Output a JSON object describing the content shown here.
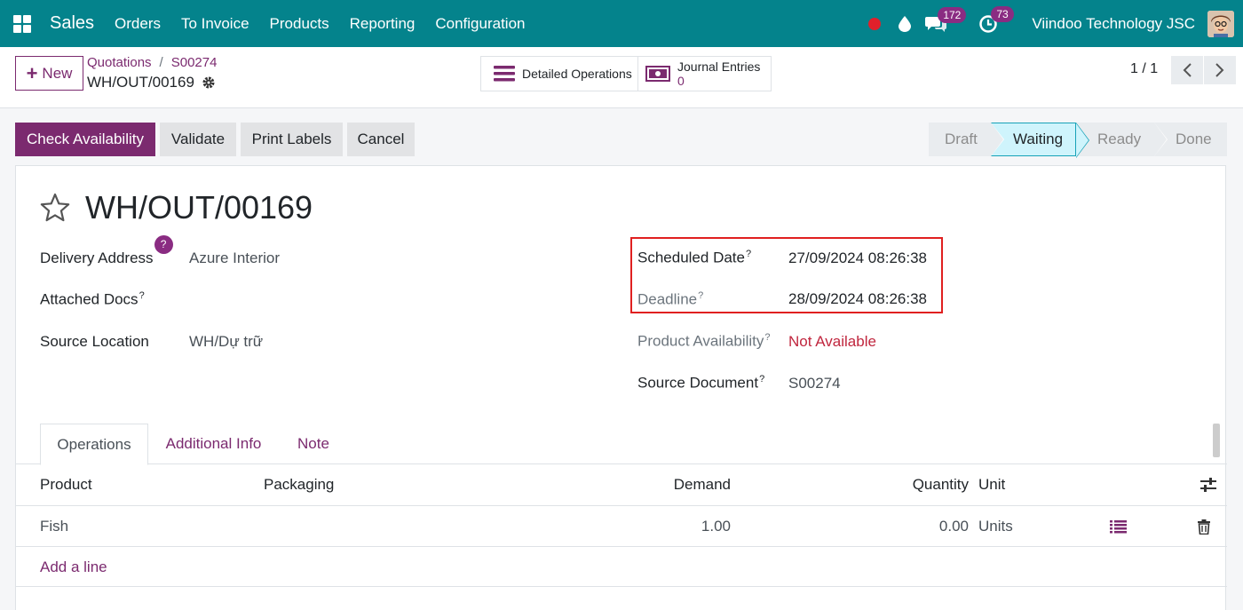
{
  "navbar": {
    "brand": "Sales",
    "menu": [
      "Orders",
      "To Invoice",
      "Products",
      "Reporting",
      "Configuration"
    ],
    "chat_count": "172",
    "activity_count": "73",
    "company": "Viindoo Technology JSC"
  },
  "control": {
    "new_label": "New",
    "breadcrumb": [
      "Quotations",
      "S00274"
    ],
    "record_name": "WH/OUT/00169",
    "detailed_operations_label": "Detailed Operations",
    "journal_entries_label": "Journal Entries",
    "journal_entries_count": "0",
    "pager": "1 / 1"
  },
  "actions": {
    "check_availability": "Check Availability",
    "validate": "Validate",
    "print_labels": "Print Labels",
    "cancel": "Cancel"
  },
  "status": {
    "stages": [
      "Draft",
      "Waiting",
      "Ready",
      "Done"
    ],
    "current": "Waiting"
  },
  "form": {
    "title": "WH/OUT/00169",
    "delivery_address_label": "Delivery Address",
    "delivery_address_help": "?",
    "delivery_address": "Azure Interior",
    "attached_docs_label": "Attached Docs",
    "source_location_label": "Source Location",
    "source_location": "WH/Dự trữ",
    "scheduled_date_label": "Scheduled Date",
    "scheduled_date": "27/09/2024 08:26:38",
    "deadline_label": "Deadline",
    "deadline": "28/09/2024 08:26:38",
    "product_availability_label": "Product Availability",
    "product_availability": "Not Available",
    "source_document_label": "Source Document",
    "source_document": "S00274",
    "help_sup": "?"
  },
  "tabs": [
    "Operations",
    "Additional Info",
    "Note"
  ],
  "table": {
    "headers": {
      "product": "Product",
      "packaging": "Packaging",
      "demand": "Demand",
      "quantity": "Quantity",
      "unit": "Unit"
    },
    "rows": [
      {
        "product": "Fish",
        "packaging": "",
        "demand": "1.00",
        "quantity": "0.00",
        "unit": "Units"
      }
    ],
    "add_line": "Add a line"
  },
  "colors": {
    "navbar": "#04838c",
    "primary": "#7b2a6f",
    "badge": "#8a2c82",
    "danger": "#c0263e",
    "highlight": "#e02020",
    "stage_active": "#cff4fc"
  }
}
